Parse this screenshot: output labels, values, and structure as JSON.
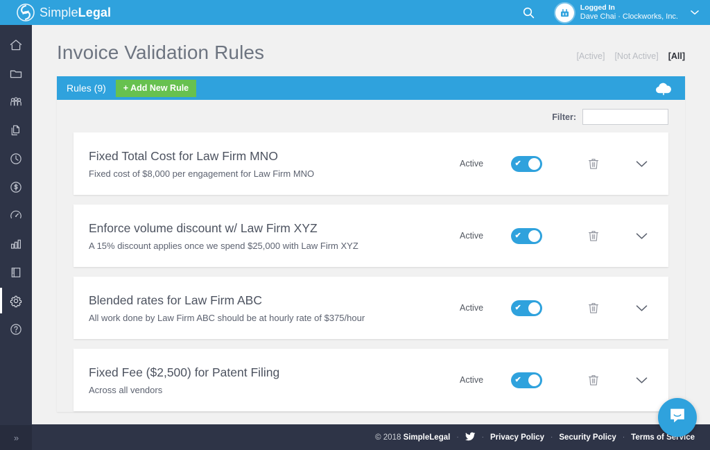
{
  "brand": {
    "name_light": "Simple",
    "name_bold": "Legal",
    "logo_icon": "spiral-logo-icon",
    "accent_blue": "#2fa2dd",
    "accent_green": "#67c14f",
    "dark_navy": "#2e3447"
  },
  "topbar": {
    "search_icon": "search-icon",
    "avatar_icon": "user-avatar-icon",
    "logged_in_label": "Logged In",
    "account_label": "Dave Chai · Clockworks, Inc.",
    "caret_icon": "chevron-down-icon"
  },
  "sidebar": {
    "items": [
      {
        "name": "home",
        "icon": "home-icon",
        "active": false
      },
      {
        "name": "matters",
        "icon": "folder-icon",
        "active": false
      },
      {
        "name": "vendors",
        "icon": "people-group-icon",
        "active": false
      },
      {
        "name": "invoices",
        "icon": "documents-icon",
        "active": false
      },
      {
        "name": "timekeeping",
        "icon": "clock-icon",
        "active": false
      },
      {
        "name": "budgets",
        "icon": "dollar-circle-icon",
        "active": false
      },
      {
        "name": "performance",
        "icon": "gauge-icon",
        "active": false
      },
      {
        "name": "reports",
        "icon": "bar-chart-icon",
        "active": false
      },
      {
        "name": "library",
        "icon": "notebook-icon",
        "active": false
      },
      {
        "name": "settings",
        "icon": "gear-icon",
        "active": true
      },
      {
        "name": "help",
        "icon": "question-circle-icon",
        "active": false
      }
    ],
    "expand_label": "»"
  },
  "page": {
    "title": "Invoice Validation Rules",
    "status_filters": [
      {
        "label": "[Active]",
        "selected": false
      },
      {
        "label": "[Not Active]",
        "selected": false
      },
      {
        "label": "[All]",
        "selected": true
      }
    ]
  },
  "panel": {
    "rules_count_label": "Rules (9)",
    "add_rule_label": "+ Add New Rule",
    "upload_icon": "cloud-upload-icon"
  },
  "filter": {
    "label": "Filter:",
    "value": "",
    "placeholder": ""
  },
  "rules": [
    {
      "title": "Fixed Total Cost for Law Firm MNO",
      "description": "Fixed cost of $8,000 per engagement for Law Firm MNO",
      "state_label": "Active",
      "toggle_on": true,
      "delete_icon": "trash-icon",
      "expand_icon": "chevron-down-icon"
    },
    {
      "title": "Enforce volume discount w/ Law Firm XYZ",
      "description": "A 15% discount applies once we spend $25,000 with Law Firm XYZ",
      "state_label": "Active",
      "toggle_on": true,
      "delete_icon": "trash-icon",
      "expand_icon": "chevron-down-icon"
    },
    {
      "title": "Blended rates for Law Firm ABC",
      "description": "All work done by Law Firm ABC should be at hourly rate of $375/hour",
      "state_label": "Active",
      "toggle_on": true,
      "delete_icon": "trash-icon",
      "expand_icon": "chevron-down-icon"
    },
    {
      "title": "Fixed Fee ($2,500) for Patent Filing",
      "description": "Across all vendors",
      "state_label": "Active",
      "toggle_on": true,
      "delete_icon": "trash-icon",
      "expand_icon": "chevron-down-icon"
    }
  ],
  "footer": {
    "copyright_prefix": "© 2018 ",
    "copyright_brand": "SimpleLegal",
    "twitter_icon": "twitter-icon",
    "links": [
      "Privacy Policy",
      "Security Policy",
      "Terms of Service"
    ],
    "separator": "·"
  },
  "intercom": {
    "icon": "chat-bubble-icon"
  }
}
